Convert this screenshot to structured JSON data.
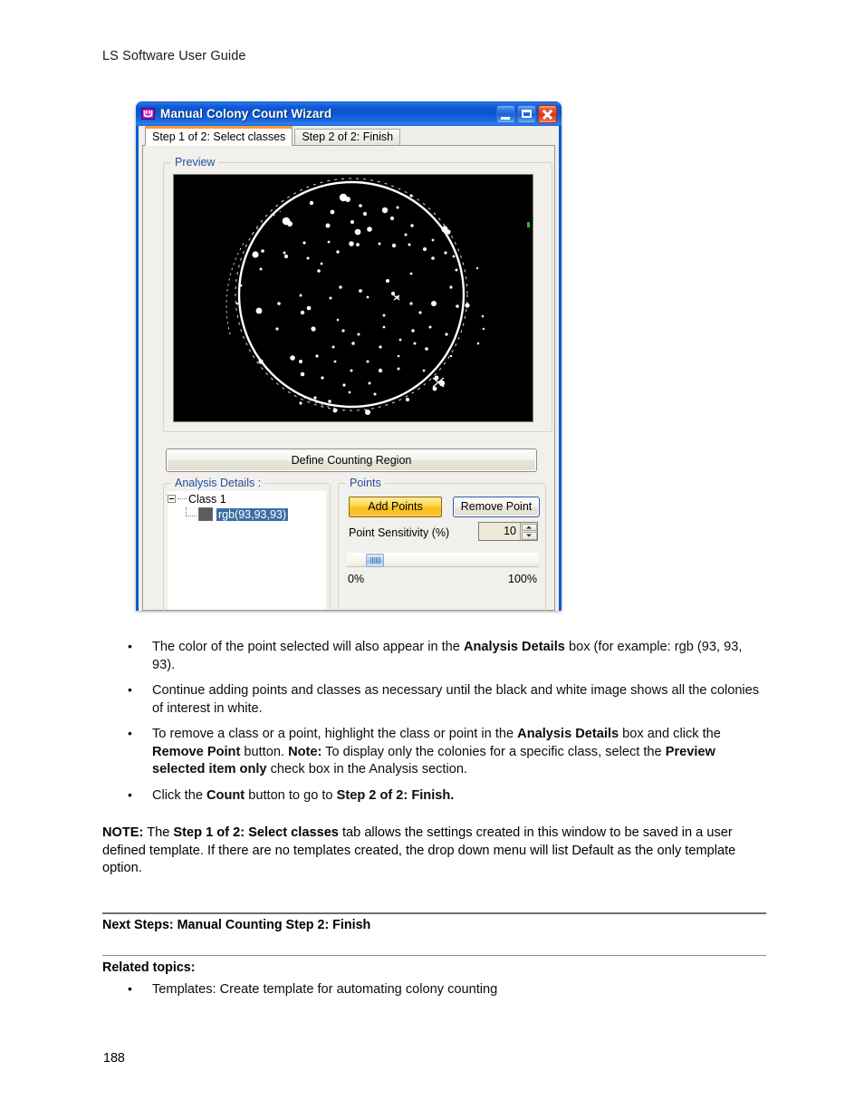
{
  "document": {
    "header": "LS Software User Guide",
    "page_number": "188"
  },
  "dialog": {
    "title": "Manual Colony Count Wizard",
    "icon": "app-icon",
    "window_controls": {
      "minimize": "Minimize",
      "maximize": "Maximize",
      "close": "Close"
    },
    "tabs": [
      {
        "label": "Step 1 of 2: Select classes",
        "active": true
      },
      {
        "label": "Step 2 of 2: Finish",
        "active": false
      }
    ],
    "preview": {
      "legend": "Preview",
      "image_description": "Binary black and white petri dish image with white colonies"
    },
    "define_region_button": "Define Counting Region",
    "analysis": {
      "legend": "Analysis Details :",
      "tree": {
        "root": "Class 1",
        "child": "rgb(93,93,93)",
        "swatch_color": "#5d5d5d",
        "child_selected": true
      }
    },
    "points": {
      "legend": "Points",
      "add_button": "Add Points",
      "remove_button": "Remove Point",
      "sensitivity_label": "Point Sensitivity (%)",
      "sensitivity_value": "10",
      "slider_min_label": "0%",
      "slider_max_label": "100%",
      "slider_position_percent": 10
    },
    "colors": {
      "titlebar_blue": "#0a5bd3",
      "active_tab_accent": "#ff9a33",
      "group_legend_blue": "#24509e",
      "add_points_yellow": "#ffd84d",
      "selection_blue": "#3a6ea5"
    }
  },
  "body": {
    "bullets": [
      {
        "parts": [
          {
            "t": "The color of the point selected will also appear in the ",
            "b": false
          },
          {
            "t": "Analysis Details",
            "b": true
          },
          {
            "t": " box (for example: rgb (93, 93, 93).",
            "b": false
          }
        ]
      },
      {
        "parts": [
          {
            "t": "Continue adding points and classes as necessary until the black and white image shows all the colonies of interest in white.",
            "b": false
          }
        ]
      },
      {
        "parts": [
          {
            "t": "To remove a class or a point, highlight the class or point in the ",
            "b": false
          },
          {
            "t": "Analysis Details",
            "b": true
          },
          {
            "t": " box and click the ",
            "b": false
          },
          {
            "t": "Remove Point",
            "b": true
          },
          {
            "t": " button. ",
            "b": false
          },
          {
            "t": "Note:",
            "b": true
          },
          {
            "t": " To display only the colonies for a specific class, select the ",
            "b": false
          },
          {
            "t": "Preview selected item only",
            "b": true
          },
          {
            "t": " check box in the Analysis section.",
            "b": false
          }
        ]
      },
      {
        "parts": [
          {
            "t": "Click the ",
            "b": false
          },
          {
            "t": "Count",
            "b": true
          },
          {
            "t": " button to go to ",
            "b": false
          },
          {
            "t": "Step 2 of 2: Finish.",
            "b": true
          }
        ]
      }
    ],
    "note": {
      "parts": [
        {
          "t": "NOTE:",
          "b": true
        },
        {
          "t": " The ",
          "b": false
        },
        {
          "t": "Step 1 of 2: Select classes",
          "b": true
        },
        {
          "t": " tab allows the settings created in this window to be saved in a user defined template. If there are no templates created, the drop down menu will list Default as the only template option.",
          "b": false
        }
      ]
    }
  },
  "footer": {
    "next_steps": "Next Steps:  Manual Counting Step 2: Finish",
    "related_topics_heading": "Related topics:",
    "related_topics": [
      "Templates: Create template for automating colony counting"
    ]
  }
}
